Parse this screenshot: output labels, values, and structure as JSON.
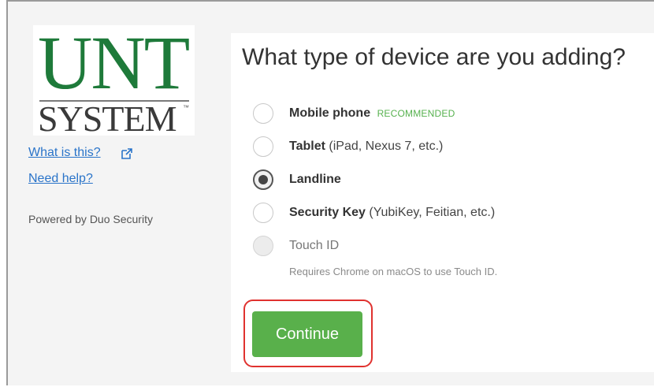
{
  "sidebar": {
    "logo": {
      "line1": "UNT",
      "line2": "SYSTEM",
      "tm": "™"
    },
    "what_is_this": "What is this?",
    "need_help": "Need help?",
    "powered_by": "Powered by Duo Security"
  },
  "main": {
    "question": "What type of device are you adding?",
    "options": [
      {
        "label": "Mobile phone",
        "detail": "",
        "badge": "RECOMMENDED",
        "selected": false,
        "disabled": false
      },
      {
        "label": "Tablet",
        "detail": "(iPad, Nexus 7, etc.)",
        "badge": "",
        "selected": false,
        "disabled": false
      },
      {
        "label": "Landline",
        "detail": "",
        "badge": "",
        "selected": true,
        "disabled": false
      },
      {
        "label": "Security Key",
        "detail": "(YubiKey, Feitian, etc.)",
        "badge": "",
        "selected": false,
        "disabled": false
      },
      {
        "label": "Touch ID",
        "detail": "",
        "badge": "",
        "selected": false,
        "disabled": true
      }
    ],
    "touch_id_note": "Requires Chrome on macOS to use Touch ID.",
    "continue_label": "Continue"
  },
  "colors": {
    "logo_green": "#1e7a3a",
    "link_blue": "#2a74c9",
    "button_green": "#59b04b",
    "highlight_red": "#e0322f",
    "recommended_green": "#56b14e"
  }
}
